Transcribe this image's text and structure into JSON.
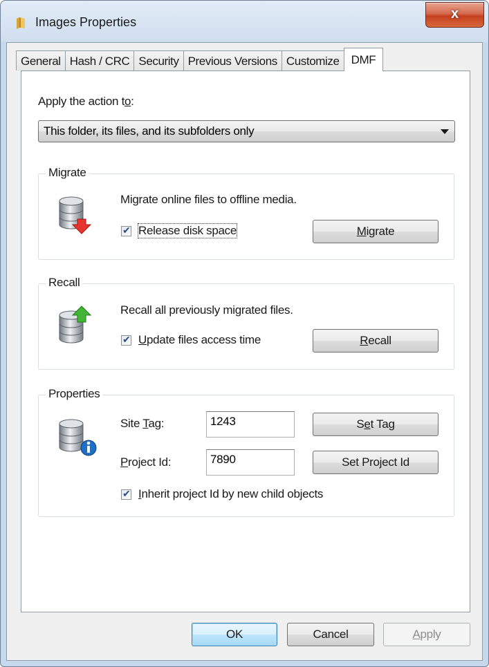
{
  "window": {
    "title": "Images Properties",
    "close_glyph": "x"
  },
  "tabs": [
    {
      "label": "General"
    },
    {
      "label": "Hash / CRC"
    },
    {
      "label": "Security"
    },
    {
      "label": "Previous Versions"
    },
    {
      "label": "Customize"
    },
    {
      "label": "DMF"
    }
  ],
  "apply": {
    "label_prefix": "Apply the action t",
    "label_accel": "o",
    "label_suffix": ":",
    "selected": "This folder, its files, and its subfolders only"
  },
  "migrate": {
    "title": "Migrate",
    "description": "Migrate online files to offline media.",
    "checkbox_label": "Release disk space",
    "checked": true,
    "button_accel": "M",
    "button_rest": "igrate"
  },
  "recall": {
    "title": "Recall",
    "description": "Recall all previously migrated files.",
    "checkbox_accel": "U",
    "checkbox_rest": "pdate files access time",
    "checked": true,
    "button_accel": "R",
    "button_rest": "ecall"
  },
  "properties": {
    "title": "Properties",
    "site_tag_label_prefix": "Site ",
    "site_tag_label_accel": "T",
    "site_tag_label_suffix": "ag:",
    "site_tag_value": "1243",
    "set_tag_prefix": "S",
    "set_tag_accel": "e",
    "set_tag_suffix": "t Tag",
    "project_id_label_accel": "P",
    "project_id_label_rest": "roject Id:",
    "project_id_value": "7890",
    "set_project_id": "Set Project Id",
    "inherit_accel": "I",
    "inherit_rest": "nherit project Id by new child objects",
    "inherit_checked": true
  },
  "footer": {
    "ok": "OK",
    "cancel": "Cancel",
    "apply_accel": "A",
    "apply_rest": "pply"
  },
  "colors": {
    "accent_border": "#3c7fb1",
    "close_red": "#c4401f"
  }
}
